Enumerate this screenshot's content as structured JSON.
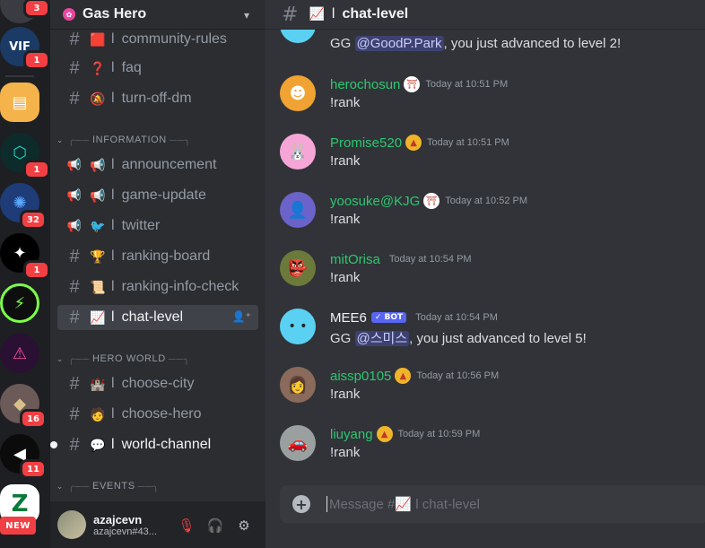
{
  "servers": [
    {
      "badge": "3",
      "color": "#3a3c42"
    },
    {
      "badge": "1",
      "color": "#1b3b66",
      "glyph": "VIF"
    },
    {
      "badge": "",
      "color": "#f4b34b",
      "glyph": "▤"
    },
    {
      "badge": "1",
      "color": "#0d2b2b",
      "glyph": "⬡"
    },
    {
      "badge": "32",
      "color": "#1e3c78",
      "glyph": "✺"
    },
    {
      "badge": "1",
      "color": "#000000",
      "glyph": "✦"
    },
    {
      "badge": "",
      "color": "#0e0e0e",
      "glyph": "⚡"
    },
    {
      "badge": "",
      "color": "#2a1133",
      "glyph": "⚠"
    },
    {
      "badge": "16",
      "color": "#6b5a58",
      "glyph": "◆"
    },
    {
      "badge": "11",
      "color": "#0b0b0b",
      "glyph": "◀"
    },
    {
      "badge": "",
      "color": "#ffffff",
      "glyph": "Z"
    }
  ],
  "rail_new": "NEW",
  "guild": {
    "name": "Gas Hero"
  },
  "channels": [
    {
      "name": "community-rules",
      "emoji": "🟥",
      "icon": "hash"
    },
    {
      "name": "faq",
      "emoji": "❓",
      "icon": "hash"
    },
    {
      "name": "turn-off-dm",
      "emoji": "🔕",
      "icon": "hash"
    },
    {
      "name": "announcement",
      "emoji": "📢",
      "icon": "megaphone"
    },
    {
      "name": "game-update",
      "emoji": "📢",
      "icon": "megaphone"
    },
    {
      "name": "twitter",
      "emoji": "🐦",
      "icon": "megaphone"
    },
    {
      "name": "ranking-board",
      "emoji": "🏆",
      "icon": "hash"
    },
    {
      "name": "ranking-info-check",
      "emoji": "📜",
      "icon": "hash"
    },
    {
      "name": "chat-level",
      "emoji": "📈",
      "icon": "hash"
    },
    {
      "name": "choose-city",
      "emoji": "🏰",
      "icon": "hash"
    },
    {
      "name": "choose-hero",
      "emoji": "🧑",
      "icon": "hash"
    },
    {
      "name": "world-channel",
      "emoji": "💬",
      "icon": "hash"
    }
  ],
  "categories": {
    "information": "INFORMATION",
    "hero_world": "HERO WORLD",
    "events": "EVENTS"
  },
  "channel_prefix": "l",
  "user": {
    "name": "azajcevn",
    "tag": "azajcevn#43..."
  },
  "chat": {
    "title": "chat-level",
    "title_emoji": "📈",
    "composer_placeholder": "Message #📈 l chat-level"
  },
  "messages": [
    {
      "author": "",
      "time": "",
      "pre": "GG ",
      "mention": "@GoodP.Park",
      "post": ", you just advanced to level 2!",
      "color": "#dbdee1"
    },
    {
      "author": "herochosun",
      "time": "Today at 10:51 PM",
      "text": "!rank",
      "color": "#2dc770"
    },
    {
      "author": "Promise520",
      "time": "Today at 10:51 PM",
      "text": "!rank",
      "color": "#2dc770"
    },
    {
      "author": "yoosuke@KJG",
      "time": "Today at 10:52 PM",
      "text": "!rank",
      "color": "#2dc770"
    },
    {
      "author": "mitOrisa",
      "time": "Today at 10:54 PM",
      "text": "!rank",
      "color": "#2dc770"
    },
    {
      "author": "MEE6",
      "time": "Today at 10:54 PM",
      "bot": "BOT",
      "pre": "GG ",
      "mention": "@스미스",
      "post": ", you just advanced to level 5!",
      "color": "#f2f3f5"
    },
    {
      "author": "aissp0105",
      "time": "Today at 10:56 PM",
      "text": "!rank",
      "color": "#2dc770"
    },
    {
      "author": "liuyang",
      "time": "Today at 10:59 PM",
      "text": "!rank",
      "color": "#2dc770"
    }
  ]
}
